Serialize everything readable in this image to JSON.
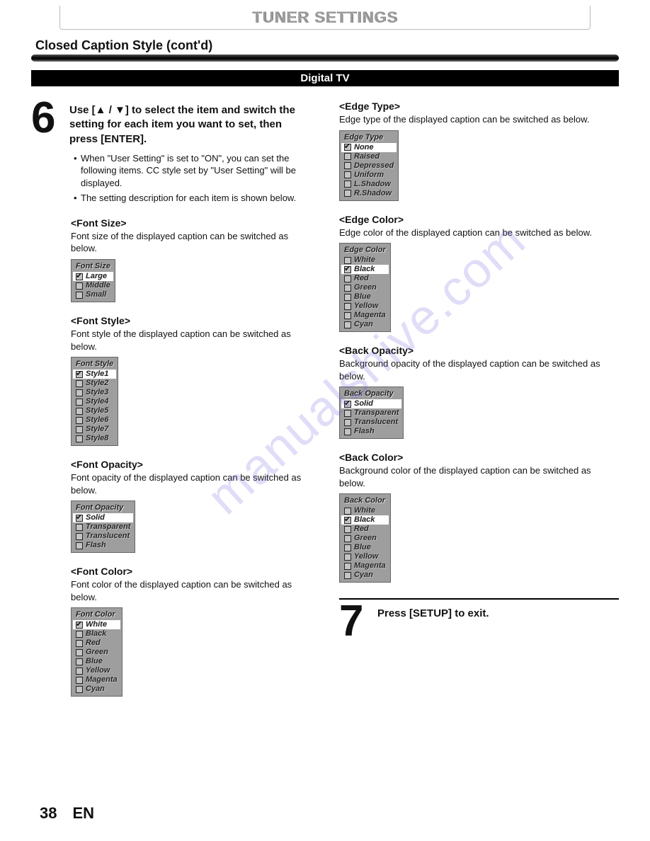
{
  "header": {
    "title": "TUNER SETTINGS"
  },
  "section": {
    "title": "Closed Caption Style (cont'd)"
  },
  "bar": {
    "label": "Digital TV"
  },
  "step6": {
    "number": "6",
    "text": "Use [▲ / ▼] to select the item and switch the setting for each item you want to set, then press [ENTER].",
    "bullet1": "When \"User Setting\" is set to \"ON\", you can set the following items. CC style set by \"User Setting\" will be displayed.",
    "bullet2": "The setting description for each item is shown below."
  },
  "fontSize": {
    "title": "<Font Size>",
    "desc": "Font size of the displayed caption can be switched as below.",
    "menuTitle": "Font Size",
    "opt0": "Large",
    "opt1": "Middle",
    "opt2": "Small"
  },
  "fontStyle": {
    "title": "<Font Style>",
    "desc": "Font style of the displayed caption can be switched as below.",
    "menuTitle": "Font Style",
    "opt0": "Style1",
    "opt1": "Style2",
    "opt2": "Style3",
    "opt3": "Style4",
    "opt4": "Style5",
    "opt5": "Style6",
    "opt6": "Style7",
    "opt7": "Style8"
  },
  "fontOpacity": {
    "title": "<Font Opacity>",
    "desc": "Font opacity of the displayed caption can be switched as below.",
    "menuTitle": "Font Opacity",
    "opt0": "Solid",
    "opt1": "Transparent",
    "opt2": "Translucent",
    "opt3": "Flash"
  },
  "fontColor": {
    "title": "<Font Color>",
    "desc": "Font color of the displayed caption can be switched as below.",
    "menuTitle": "Font Color",
    "opt0": "White",
    "opt1": "Black",
    "opt2": "Red",
    "opt3": "Green",
    "opt4": "Blue",
    "opt5": "Yellow",
    "opt6": "Magenta",
    "opt7": "Cyan"
  },
  "edgeType": {
    "title": "<Edge Type>",
    "desc": "Edge type of the displayed caption can be switched as below.",
    "menuTitle": "Edge Type",
    "opt0": "None",
    "opt1": "Raised",
    "opt2": "Depressed",
    "opt3": "Uniform",
    "opt4": "L.Shadow",
    "opt5": "R.Shadow"
  },
  "edgeColor": {
    "title": "<Edge Color>",
    "desc": "Edge color of the displayed caption can be switched as below.",
    "menuTitle": "Edge Color",
    "opt0": "White",
    "opt1": "Black",
    "opt2": "Red",
    "opt3": "Green",
    "opt4": "Blue",
    "opt5": "Yellow",
    "opt6": "Magenta",
    "opt7": "Cyan"
  },
  "backOpacity": {
    "title": "<Back Opacity>",
    "desc": "Background opacity of the displayed caption can be switched as below.",
    "menuTitle": "Back Opacity",
    "opt0": "Solid",
    "opt1": "Transparent",
    "opt2": "Translucent",
    "opt3": "Flash"
  },
  "backColor": {
    "title": "<Back Color>",
    "desc": "Background color of the displayed caption can be switched as below.",
    "menuTitle": "Back Color",
    "opt0": "White",
    "opt1": "Black",
    "opt2": "Red",
    "opt3": "Green",
    "opt4": "Blue",
    "opt5": "Yellow",
    "opt6": "Magenta",
    "opt7": "Cyan"
  },
  "step7": {
    "number": "7",
    "text": "Press [SETUP] to exit."
  },
  "footer": {
    "page": "38",
    "lang": "EN"
  },
  "watermark": {
    "text": "manualshive.com"
  }
}
